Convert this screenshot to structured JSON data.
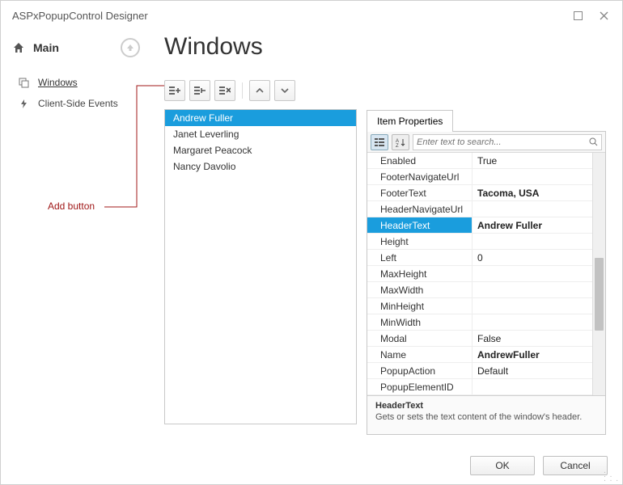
{
  "title": "ASPxPopupControl Designer",
  "sidebar": {
    "main_label": "Main",
    "items": [
      {
        "label": "Windows",
        "icon": "windows-icon",
        "selected": true
      },
      {
        "label": "Client-Side Events",
        "icon": "bolt-icon",
        "selected": false
      }
    ]
  },
  "callout_label": "Add button",
  "page_heading": "Windows",
  "list_items": [
    {
      "label": "Andrew Fuller",
      "selected": true
    },
    {
      "label": "Janet Leverling",
      "selected": false
    },
    {
      "label": "Margaret Peacock",
      "selected": false
    },
    {
      "label": "Nancy Davolio",
      "selected": false
    }
  ],
  "properties_tab": "Item Properties",
  "search_placeholder": "Enter text to search...",
  "properties": [
    {
      "name": "Enabled",
      "value": "True",
      "bold": false
    },
    {
      "name": "FooterNavigateUrl",
      "value": "",
      "bold": false
    },
    {
      "name": "FooterText",
      "value": "Tacoma, USA",
      "bold": true
    },
    {
      "name": "HeaderNavigateUrl",
      "value": "",
      "bold": false
    },
    {
      "name": "HeaderText",
      "value": "Andrew Fuller",
      "bold": true,
      "selected": true
    },
    {
      "name": "Height",
      "value": "",
      "bold": false
    },
    {
      "name": "Left",
      "value": "0",
      "bold": false
    },
    {
      "name": "MaxHeight",
      "value": "",
      "bold": false
    },
    {
      "name": "MaxWidth",
      "value": "",
      "bold": false
    },
    {
      "name": "MinHeight",
      "value": "",
      "bold": false
    },
    {
      "name": "MinWidth",
      "value": "",
      "bold": false
    },
    {
      "name": "Modal",
      "value": "False",
      "bold": false
    },
    {
      "name": "Name",
      "value": "AndrewFuller",
      "bold": true
    },
    {
      "name": "PopupAction",
      "value": "Default",
      "bold": false
    },
    {
      "name": "PopupElementID",
      "value": "",
      "bold": false
    }
  ],
  "description": {
    "title": "HeaderText",
    "body": "Gets or sets the text content of the window's header."
  },
  "footer": {
    "ok": "OK",
    "cancel": "Cancel"
  }
}
